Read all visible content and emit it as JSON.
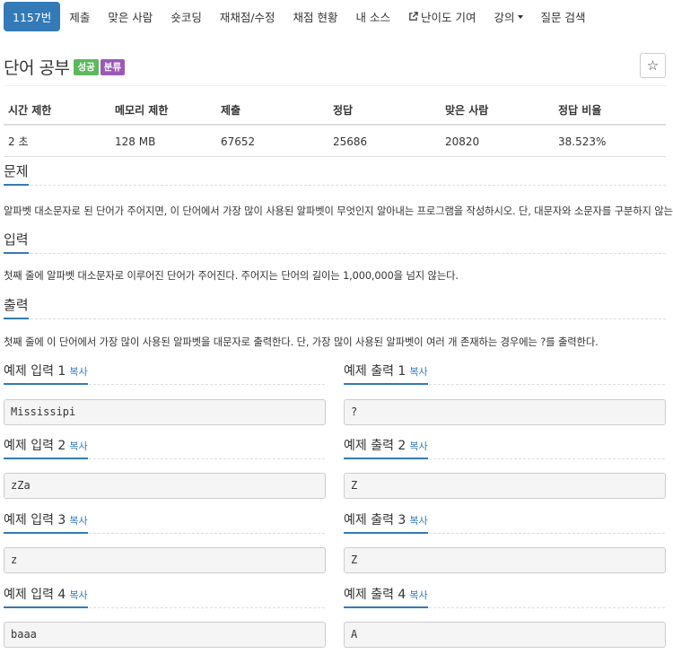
{
  "nav": {
    "items": [
      {
        "label": "1157번"
      },
      {
        "label": "제출"
      },
      {
        "label": "맞은 사람"
      },
      {
        "label": "숏코딩"
      },
      {
        "label": "재채점/수정"
      },
      {
        "label": "채점 현황"
      },
      {
        "label": "내 소스"
      },
      {
        "label": "난이도 기여"
      },
      {
        "label": "강의"
      },
      {
        "label": "질문 검색"
      }
    ]
  },
  "header": {
    "title": "단어 공부",
    "badges": [
      "성공",
      "분류"
    ],
    "star": "☆"
  },
  "info": {
    "headers": [
      "시간 제한",
      "메모리 제한",
      "제출",
      "정답",
      "맞은 사람",
      "정답 비율"
    ],
    "values": [
      "2 초",
      "128 MB",
      "67652",
      "25686",
      "20820",
      "38.523%"
    ]
  },
  "problem": {
    "title": "문제",
    "text": "알파벳 대소문자로 된 단어가 주어지면, 이 단어에서 가장 많이 사용된 알파벳이 무엇인지 알아내는 프로그램을 작성하시오. 단, 대문자와 소문자를 구분하지 않는다."
  },
  "input": {
    "title": "입력",
    "text": "첫째 줄에 알파벳 대소문자로 이루어진 단어가 주어진다. 주어지는 단어의 길이는 1,000,000을 넘지 않는다."
  },
  "output": {
    "title": "출력",
    "text": "첫째 줄에 이 단어에서 가장 많이 사용된 알파벳을 대문자로 출력한다. 단, 가장 많이 사용된 알파벳이 여러 개 존재하는 경우에는 ?를 출력한다."
  },
  "copy_label": "복사",
  "samples": [
    {
      "in_title": "예제 입력 1",
      "in": "Mississipi",
      "out_title": "예제 출력 1",
      "out": "?"
    },
    {
      "in_title": "예제 입력 2",
      "in": "zZa",
      "out_title": "예제 출력 2",
      "out": "Z"
    },
    {
      "in_title": "예제 입력 3",
      "in": "z",
      "out_title": "예제 출력 3",
      "out": "Z"
    },
    {
      "in_title": "예제 입력 4",
      "in": "baaa",
      "out_title": "예제 출력 4",
      "out": "A"
    }
  ],
  "colors": {
    "primary": "#337ab7",
    "success": "#5cb85c",
    "class_badge": "#9b59b6"
  }
}
